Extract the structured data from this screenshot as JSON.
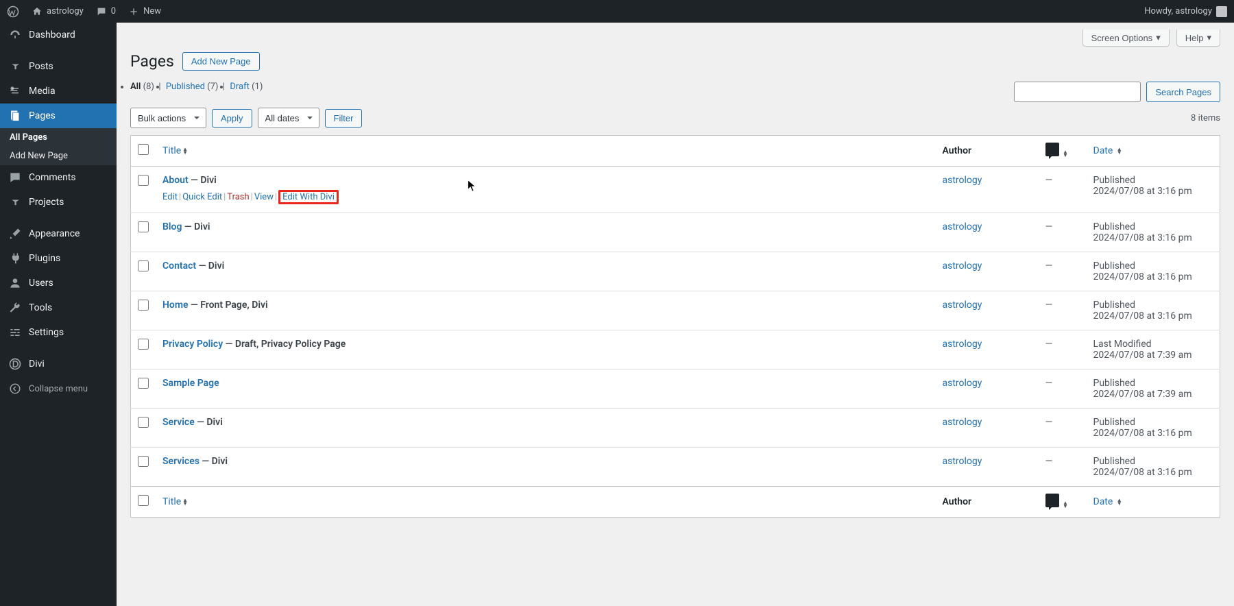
{
  "adminbar": {
    "site_name": "astrology",
    "comments_count": "0",
    "new_label": "New",
    "howdy": "Howdy, astrology"
  },
  "sidebar": {
    "items": [
      {
        "id": "dashboard",
        "label": "Dashboard",
        "icon": "dashboard"
      },
      {
        "id": "posts",
        "label": "Posts",
        "icon": "pin"
      },
      {
        "id": "media",
        "label": "Media",
        "icon": "media"
      },
      {
        "id": "pages",
        "label": "Pages",
        "icon": "pages",
        "active": true
      },
      {
        "id": "comments",
        "label": "Comments",
        "icon": "comment"
      },
      {
        "id": "projects",
        "label": "Projects",
        "icon": "pin"
      },
      {
        "id": "appearance",
        "label": "Appearance",
        "icon": "brush"
      },
      {
        "id": "plugins",
        "label": "Plugins",
        "icon": "plug"
      },
      {
        "id": "users",
        "label": "Users",
        "icon": "user"
      },
      {
        "id": "tools",
        "label": "Tools",
        "icon": "wrench"
      },
      {
        "id": "settings",
        "label": "Settings",
        "icon": "sliders"
      },
      {
        "id": "divi",
        "label": "Divi",
        "icon": "divi"
      }
    ],
    "sub": [
      "All Pages",
      "Add New Page"
    ],
    "collapse": "Collapse menu"
  },
  "screen_options": "Screen Options",
  "help": "Help",
  "page": {
    "title": "Pages",
    "add_new": "Add New Page",
    "filters": {
      "all_label": "All",
      "all_count": "(8)",
      "published_label": "Published",
      "published_count": "(7)",
      "draft_label": "Draft",
      "draft_count": "(1)"
    },
    "bulk_label": "Bulk actions",
    "apply": "Apply",
    "dates": "All dates",
    "filter": "Filter",
    "search": "Search Pages",
    "items_count": "8 items"
  },
  "columns": {
    "title": "Title",
    "author": "Author",
    "date": "Date"
  },
  "row_actions": {
    "edit": "Edit",
    "quick_edit": "Quick Edit",
    "trash": "Trash",
    "view": "View",
    "edit_divi": "Edit With Divi"
  },
  "rows": [
    {
      "title": "About",
      "state": " — Divi",
      "author": "astrology",
      "comments": "—",
      "status": "Published",
      "date": "2024/07/08 at 3:16 pm",
      "show_actions": true
    },
    {
      "title": "Blog",
      "state": " — Divi",
      "author": "astrology",
      "comments": "—",
      "status": "Published",
      "date": "2024/07/08 at 3:16 pm"
    },
    {
      "title": "Contact",
      "state": " — Divi",
      "author": "astrology",
      "comments": "—",
      "status": "Published",
      "date": "2024/07/08 at 3:16 pm"
    },
    {
      "title": "Home",
      "state": " — Front Page, Divi",
      "author": "astrology",
      "comments": "—",
      "status": "Published",
      "date": "2024/07/08 at 3:16 pm"
    },
    {
      "title": "Privacy Policy",
      "state": " — Draft, Privacy Policy Page",
      "author": "astrology",
      "comments": "—",
      "status": "Last Modified",
      "date": "2024/07/08 at 7:39 am"
    },
    {
      "title": "Sample Page",
      "state": "",
      "author": "astrology",
      "comments": "—",
      "status": "Published",
      "date": "2024/07/08 at 7:39 am"
    },
    {
      "title": "Service",
      "state": " — Divi",
      "author": "astrology",
      "comments": "—",
      "status": "Published",
      "date": "2024/07/08 at 3:16 pm"
    },
    {
      "title": "Services",
      "state": " — Divi",
      "author": "astrology",
      "comments": "—",
      "status": "Published",
      "date": "2024/07/08 at 3:16 pm"
    }
  ]
}
